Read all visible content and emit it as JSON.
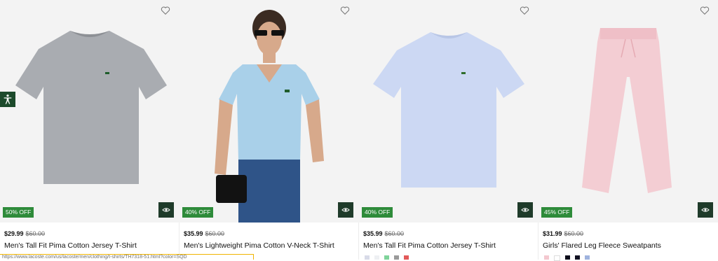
{
  "products": [
    {
      "discount": "50% OFF",
      "price": "$29.99",
      "original_price": "$60.00",
      "name": "Men's Tall Fit Pima Cotton Jersey T-Shirt",
      "image_desc": "grey-tshirt",
      "swatch_colors": []
    },
    {
      "discount": "40% OFF",
      "price": "$35.99",
      "original_price": "$60.00",
      "name": "Men's Lightweight Pima Cotton V-Neck T-Shirt",
      "image_desc": "model-light-blue-vneck",
      "swatch_colors": []
    },
    {
      "discount": "40% OFF",
      "price": "$35.99",
      "original_price": "$60.00",
      "name": "Men's Tall Fit Pima Cotton Jersey T-Shirt",
      "image_desc": "light-blue-tshirt",
      "swatch_colors": [
        "#d8dbe8",
        "#eef0f3",
        "#7fd39a",
        "#9a9a9a",
        "#e25a5a"
      ]
    },
    {
      "discount": "45% OFF",
      "price": "$31.99",
      "original_price": "$60.00",
      "name": "Girls' Flared Leg Fleece Sweatpants",
      "image_desc": "pink-sweatpants",
      "swatch_colors": [
        "#f4c8cf",
        "#ffffff",
        "#0c0c1a",
        "#111122",
        "#9fb3de"
      ]
    }
  ],
  "icons": {
    "wishlist": "heart-icon",
    "quick_view": "eye-icon",
    "accessibility": "accessibility-icon"
  },
  "colors": {
    "badge": "#2e8b3a",
    "quick_view_bg": "#1f3b2a",
    "accessibility_bg": "#1c4a2b"
  },
  "status_bar": {
    "url": "https://www.lacoste.com/us/lacoste/men/clothing/t-shirts/TH7318-51.html?color=SQD"
  }
}
